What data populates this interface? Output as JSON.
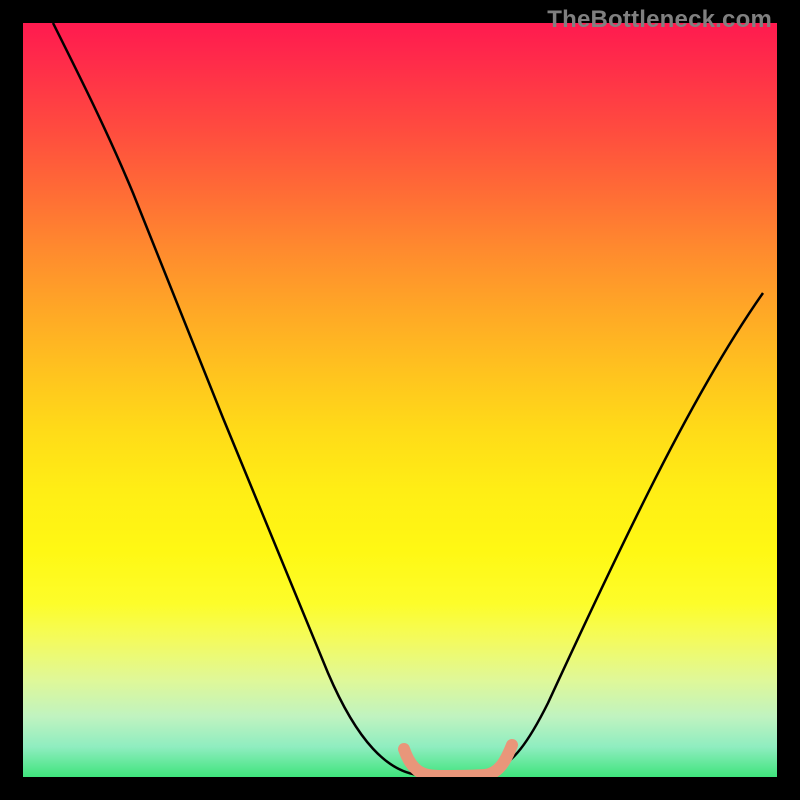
{
  "watermark": "TheBottleneck.com",
  "chart_data": {
    "type": "line",
    "title": "",
    "xlabel": "",
    "ylabel": "",
    "xlim": [
      0,
      1
    ],
    "ylim": [
      0,
      1
    ],
    "series": [
      {
        "name": "bottleneck-curve",
        "color": "#000000",
        "x": [
          0.04,
          0.08,
          0.12,
          0.16,
          0.2,
          0.24,
          0.28,
          0.32,
          0.36,
          0.4,
          0.44,
          0.48,
          0.51,
          0.53,
          0.56,
          0.6,
          0.63,
          0.66,
          0.7,
          0.74,
          0.78,
          0.82,
          0.86,
          0.9,
          0.94,
          0.98
        ],
        "y": [
          1.0,
          0.935,
          0.855,
          0.77,
          0.685,
          0.6,
          0.513,
          0.425,
          0.34,
          0.255,
          0.17,
          0.085,
          0.025,
          0.005,
          0.0,
          0.0,
          0.007,
          0.04,
          0.12,
          0.21,
          0.3,
          0.38,
          0.455,
          0.525,
          0.585,
          0.64
        ]
      },
      {
        "name": "optimal-range-marker",
        "color": "#E9967A",
        "x": [
          0.505,
          0.515,
          0.525,
          0.54,
          0.56,
          0.58,
          0.6,
          0.615,
          0.63,
          0.64
        ],
        "y": [
          0.035,
          0.02,
          0.01,
          0.005,
          0.003,
          0.003,
          0.004,
          0.01,
          0.022,
          0.038
        ]
      }
    ]
  }
}
